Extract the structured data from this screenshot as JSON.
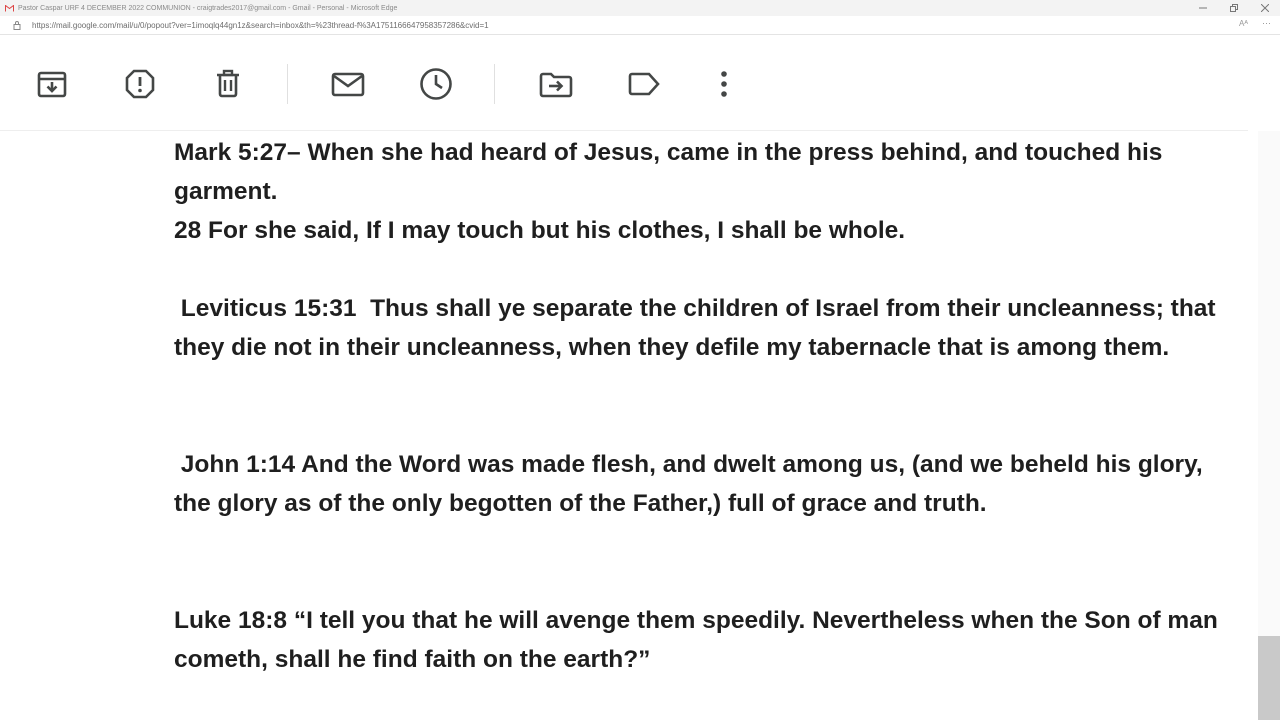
{
  "window": {
    "title": "Pastor Caspar URF 4 DECEMBER 2022 COMMUNION - craigtrades2017@gmail.com - Gmail - Personal - Microsoft Edge",
    "controls": [
      "minimize-icon",
      "restore-icon",
      "close-icon"
    ]
  },
  "address": {
    "url": "https://mail.google.com/mail/u/0/popout?ver=1imoqlq44gn1z&search=inbox&th=%23thread-f%3A1751166647958357286&cvid=1",
    "read_aloud_glyph": "Aᴬ",
    "more_glyph": "⋯"
  },
  "toolbar": {
    "buttons": [
      {
        "name": "archive-button",
        "icon": "archive-icon",
        "label": "Archive"
      },
      {
        "name": "report-spam-button",
        "icon": "report-spam-icon",
        "label": "Report spam"
      },
      {
        "name": "delete-button",
        "icon": "trash-icon",
        "label": "Delete"
      },
      {
        "name": "mark-unread-button",
        "icon": "mail-icon",
        "label": "Mark as unread"
      },
      {
        "name": "snooze-button",
        "icon": "clock-icon",
        "label": "Snooze"
      },
      {
        "name": "move-to-button",
        "icon": "move-to-folder-icon",
        "label": "Move to"
      },
      {
        "name": "labels-button",
        "icon": "label-icon",
        "label": "Labels"
      },
      {
        "name": "more-button",
        "icon": "more-vert-icon",
        "label": "More"
      }
    ]
  },
  "message": {
    "p1": "Mark 5:27– When she had heard of Jesus, came in the press behind, and touched his garment.",
    "p2": "28 For she said, If I may touch but his clothes, I shall be whole.",
    "p3": " Leviticus 15:31  Thus shall ye separate the children of Israel from their uncleanness; that they die not in their uncleanness, when they defile my tabernacle that is among them.",
    "p4": " John 1:14 And the Word was made flesh, and dwelt among us, (and we beheld his glory, the glory as of the only begotten of the Father,) full of grace and truth.",
    "p5": "Luke 18:8 “I tell you that he will avenge them speedily. Nevertheless when the Son of man cometh, shall he find faith on the earth?”"
  },
  "colors": {
    "text": "#1f1f1f",
    "icon": "#444746",
    "scroll_thumb": "#c9c9c9"
  }
}
